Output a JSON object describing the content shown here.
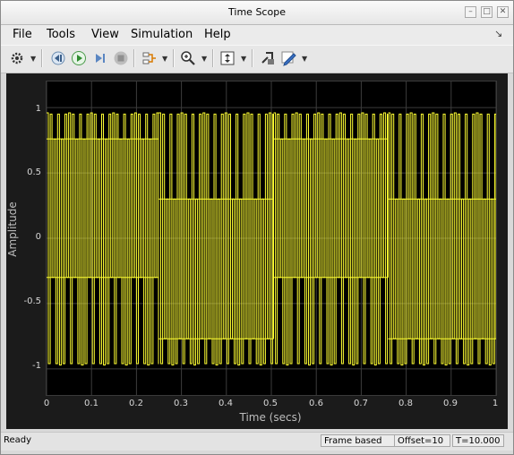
{
  "window": {
    "title": "Time Scope"
  },
  "menu": [
    "File",
    "Tools",
    "View",
    "Simulation",
    "Help"
  ],
  "toolbar": {
    "icons": [
      "gear-icon",
      "step-back-icon",
      "run-icon",
      "step-forward-icon",
      "stop-icon",
      "signal-select-icon",
      "zoom-in-icon",
      "scale-axes-icon",
      "highlight-block-icon",
      "style-pencil-icon"
    ]
  },
  "chart_data": {
    "type": "line",
    "xlabel": "Time (secs)",
    "ylabel": "Amplitude",
    "xlim": [
      0,
      1
    ],
    "ylim": [
      -1.2,
      1.2
    ],
    "x_ticks": [
      "0",
      "0.1",
      "0.2",
      "0.3",
      "0.4",
      "0.5",
      "0.6",
      "0.7",
      "0.8",
      "0.9",
      "1"
    ],
    "y_ticks": [
      "1",
      "0.5",
      "0",
      "-0.5",
      "-1"
    ],
    "y_tick_values": [
      1,
      0.5,
      0,
      -0.5,
      -1
    ],
    "grid": true,
    "background": "#000000",
    "series": [
      {
        "color": "#ffff33",
        "segments": [
          {
            "x": [
              0,
              0.25
            ],
            "high_level": 0.76,
            "low_level": -0.3,
            "upper_envelope": 0.96,
            "lower_envelope": -0.97
          },
          {
            "x": [
              0.25,
              0.505
            ],
            "high_level": 0.3,
            "low_level": -0.77,
            "upper_envelope": 0.96,
            "lower_envelope": -0.97
          },
          {
            "x": [
              0.505,
              0.76
            ],
            "high_level": 0.76,
            "low_level": -0.3,
            "upper_envelope": 0.96,
            "lower_envelope": -0.97
          },
          {
            "x": [
              0.76,
              1.0
            ],
            "high_level": 0.3,
            "low_level": -0.77,
            "upper_envelope": 0.96,
            "lower_envelope": -0.97
          }
        ]
      }
    ]
  },
  "status": {
    "state": "Ready",
    "mode": "Frame based",
    "offset": "Offset=10",
    "time": "T=10.000"
  }
}
